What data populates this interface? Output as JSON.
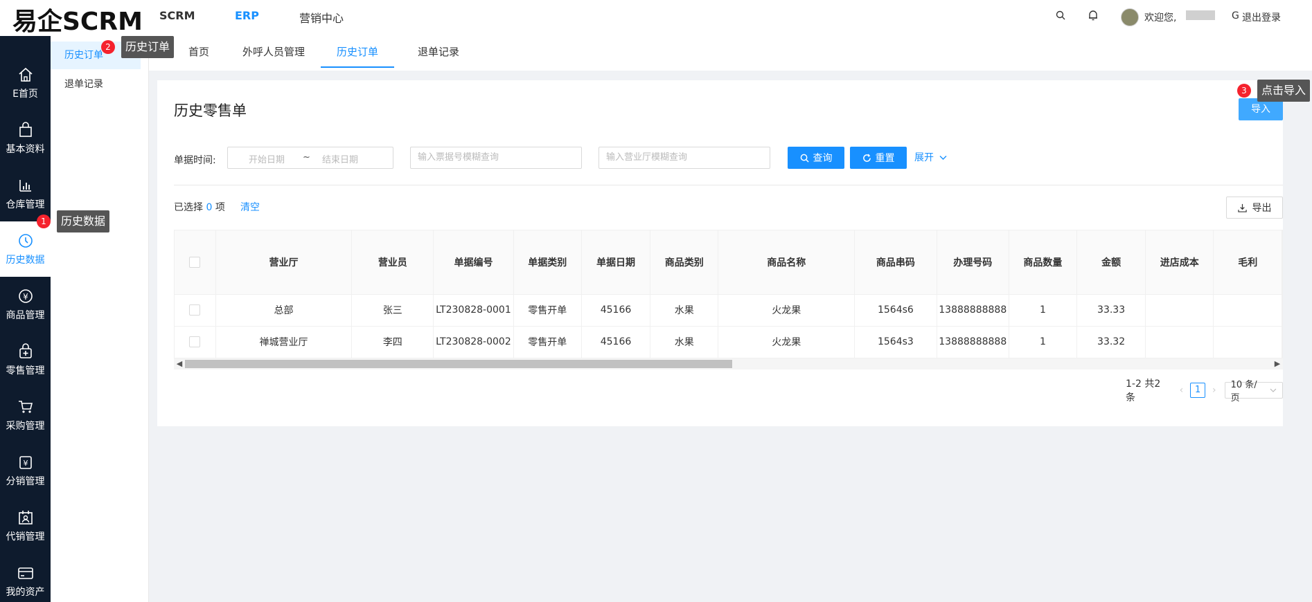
{
  "header": {
    "logo": "易企SCRM",
    "nav": [
      "SCRM",
      "ERP",
      "营销中心"
    ],
    "welcome": "欢迎您,",
    "logout": "退出登录"
  },
  "sidebar": {
    "items": [
      {
        "label": "E首页",
        "icon": "home-icon"
      },
      {
        "label": "基本资料",
        "icon": "bag-icon"
      },
      {
        "label": "仓库管理",
        "icon": "bar-chart-icon"
      },
      {
        "label": "历史数据",
        "icon": "clock-icon"
      },
      {
        "label": "商品管理",
        "icon": "yen-circle-icon"
      },
      {
        "label": "零售管理",
        "icon": "retail-bag-icon"
      },
      {
        "label": "采购管理",
        "icon": "cart-icon"
      },
      {
        "label": "分销管理",
        "icon": "yen-bag-icon"
      },
      {
        "label": "代销管理",
        "icon": "calendar-user-icon"
      },
      {
        "label": "我的资产",
        "icon": "card-icon"
      }
    ]
  },
  "submenu": {
    "items": [
      "历史订单",
      "退单记录"
    ]
  },
  "tabs": [
    "首页",
    "外呼人员管理",
    "历史订单",
    "退单记录"
  ],
  "main": {
    "title": "历史零售单",
    "import_label": "导入",
    "filter": {
      "time_label": "单据时间:",
      "start_placeholder": "开始日期",
      "separator": "~",
      "end_placeholder": "结束日期",
      "ticket_placeholder": "输入票据号模糊查询",
      "store_placeholder": "输入营业厅模糊查询",
      "query_label": "查询",
      "reset_label": "重置",
      "expand_label": "展开"
    },
    "selection": {
      "prefix": "已选择",
      "count": "0",
      "suffix": "项",
      "clear": "清空"
    },
    "export_label": "导出",
    "table": {
      "columns": [
        "营业厅",
        "营业员",
        "单据编号",
        "单据类别",
        "单据日期",
        "商品类别",
        "商品名称",
        "商品串码",
        "办理号码",
        "商品数量",
        "金额",
        "进店成本",
        "毛利"
      ],
      "rows": [
        [
          "总部",
          "张三",
          "LT230828-0001",
          "零售开单",
          "45166",
          "水果",
          "火龙果",
          "1564s6",
          "13888888888",
          "1",
          "33.33",
          "",
          ""
        ],
        [
          "禅城营业厅",
          "李四",
          "LT230828-0002",
          "零售开单",
          "45166",
          "水果",
          "火龙果",
          "1564s3",
          "13888888888",
          "1",
          "33.32",
          "",
          ""
        ]
      ]
    },
    "pagination": {
      "summary": "1-2 共2条",
      "current": "1",
      "page_size": "10 条/页"
    }
  },
  "tooltips": {
    "t1": {
      "badge": "1",
      "text": "历史数据"
    },
    "t2": {
      "badge": "2",
      "text": "历史订单"
    },
    "t3": {
      "badge": "3",
      "text": "点击导入"
    }
  },
  "colors": {
    "primary": "#1890ff",
    "sidebar_bg": "#0e1b2d",
    "badge": "#f5222d"
  }
}
